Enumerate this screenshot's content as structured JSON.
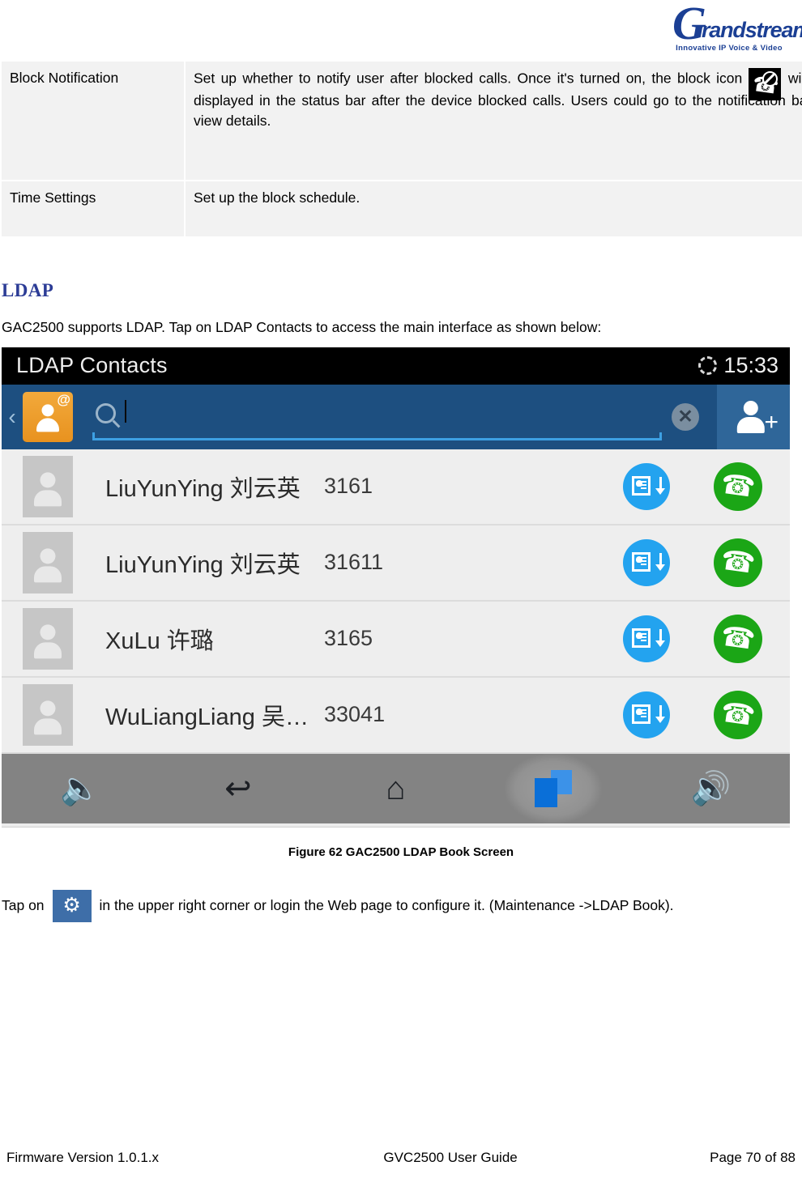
{
  "logo": {
    "letter": "G",
    "word": "randstream",
    "tagline": "Innovative IP Voice & Video"
  },
  "settings_table": {
    "rows": [
      {
        "label": "Block Notification",
        "desc_before": "Set up whether to notify user after blocked calls. Once it's turned on, the block icon",
        "icon_name": "blocked-call-icon",
        "desc_after": "will be displayed in the status bar after the device blocked calls. Users could go to the notification bar to view details."
      },
      {
        "label": "Time Settings",
        "desc_before": "Set up the block schedule.",
        "icon_name": "",
        "desc_after": ""
      }
    ]
  },
  "section": {
    "title": "LDAP",
    "intro": "GAC2500 supports LDAP. Tap on LDAP Contacts to access the main interface as shown below:"
  },
  "device": {
    "status": {
      "title": "LDAP Contacts",
      "sync_icon": "sync-icon",
      "time": "15:33"
    },
    "search": {
      "back_chevron": "‹",
      "account_icon": "ldap-account-icon",
      "at_badge": "@",
      "search_icon": "search-icon",
      "search_value": "",
      "search_placeholder": "",
      "clear_label": "✕",
      "add_contact_label": "+"
    },
    "contacts": [
      {
        "name": "LiuYunYing 刘云英",
        "number": "3161",
        "save_icon": "save-contact-icon",
        "call_icon": "call-icon"
      },
      {
        "name": "LiuYunYing 刘云英",
        "number": "31611",
        "save_icon": "save-contact-icon",
        "call_icon": "call-icon"
      },
      {
        "name": "XuLu 许璐",
        "number": "3165",
        "save_icon": "save-contact-icon",
        "call_icon": "call-icon"
      },
      {
        "name": "WuLiangLiang 吴…",
        "number": "33041",
        "save_icon": "save-contact-icon",
        "call_icon": "call-icon"
      }
    ],
    "nav": [
      {
        "name": "volume-down-button",
        "glyph": "🔈"
      },
      {
        "name": "back-button",
        "glyph": "↩"
      },
      {
        "name": "home-button",
        "glyph": "⌂"
      },
      {
        "name": "recent-apps-button",
        "glyph": ""
      },
      {
        "name": "volume-up-button",
        "glyph": "🔊"
      }
    ]
  },
  "figure": {
    "caption": "Figure 62 GAC2500 LDAP Book Screen"
  },
  "tap_text": {
    "before": "Tap on",
    "gear_icon": "gear-icon",
    "after": "in the upper right corner or login the Web page to configure it. (Maintenance ->LDAP Book)."
  },
  "footer": {
    "left": "Firmware Version 1.0.1.x",
    "middle": "GVC2500 User Guide",
    "right": "Page 70 of 88"
  },
  "colors": {
    "brand_blue": "#1b3f94",
    "heading_blue": "#2c3c96",
    "status_bar_blue": "#1d4f80",
    "accent_orange": "#e8921f",
    "call_green": "#1ba616",
    "save_blue": "#23a3ef"
  }
}
